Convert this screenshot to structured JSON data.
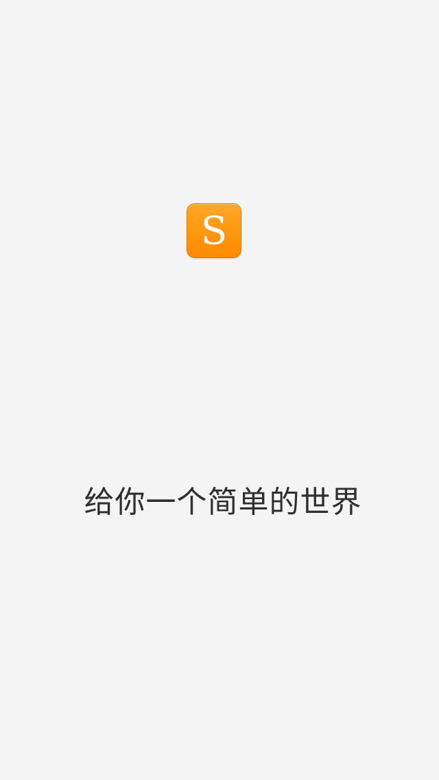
{
  "splash": {
    "logo_letter": "S",
    "slogan": "给你一个简单的世界"
  },
  "colors": {
    "background": "#f4f4f4",
    "brand_orange": "#ff9a12",
    "text": "#2f2f2f"
  },
  "icons": {
    "logo": "app-logo-s-icon"
  }
}
